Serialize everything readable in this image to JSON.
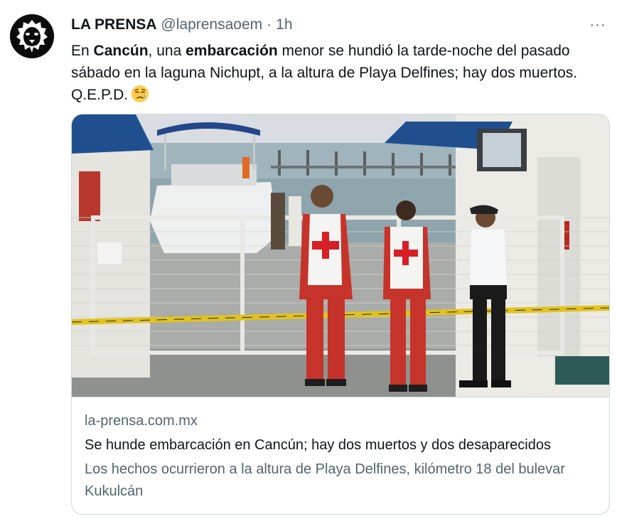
{
  "tweet": {
    "author_name": "LA PRENSA",
    "author_handle": "@laprensaoem",
    "separator": "·",
    "time": "1h",
    "more_label": "···",
    "text": {
      "p1": "En ",
      "b1": "Cancún",
      "p2": ", una ",
      "b2": "embarcación",
      "p3": " menor se hundió la tarde-noche del pasado sábado en la laguna Nichupt, a la altura de Playa Delfines; hay dos muertos. Q.E.P.D."
    },
    "emoji": "sad-relieved-face-icon"
  },
  "card": {
    "domain": "la-prensa.com.mx",
    "title": "Se hunde embarcación en Cancún; hay dos muertos y dos desaparecidos",
    "description": "Los hechos ocurrieron a la altura de Playa Delfines, kilómetro 18 del bulevar Kukulcán"
  },
  "colors": {
    "text_primary": "#0f1419",
    "text_secondary": "#536471",
    "border": "#cfd9de",
    "red_cross": "#d81f26"
  }
}
